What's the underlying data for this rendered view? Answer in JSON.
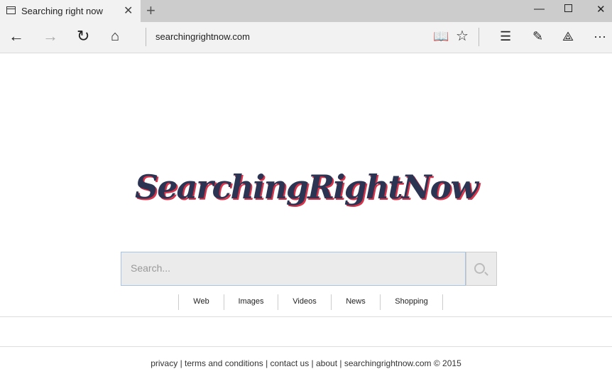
{
  "browser": {
    "tab_title": "Searching right now",
    "url": "searchingrightnow.com"
  },
  "icons": [
    "tab-page-icon",
    "close-icon",
    "plus-icon",
    "minimize-icon",
    "maximize-icon",
    "close-window-icon",
    "back-icon",
    "forward-icon",
    "refresh-icon",
    "home-icon",
    "reading-view-icon",
    "star-icon",
    "hub-icon",
    "note-icon",
    "share-icon",
    "more-icon",
    "search-icon"
  ],
  "logo": "SearchingRightNow",
  "search": {
    "placeholder": "Search..."
  },
  "categories": [
    "Web",
    "Images",
    "Videos",
    "News",
    "Shopping"
  ],
  "footer": "privacy | terms and conditions | contact us | about | searchingrightnow.com © 2015",
  "colors": {
    "logo": "#2b3553",
    "logo_shadow": "#d9344a"
  }
}
